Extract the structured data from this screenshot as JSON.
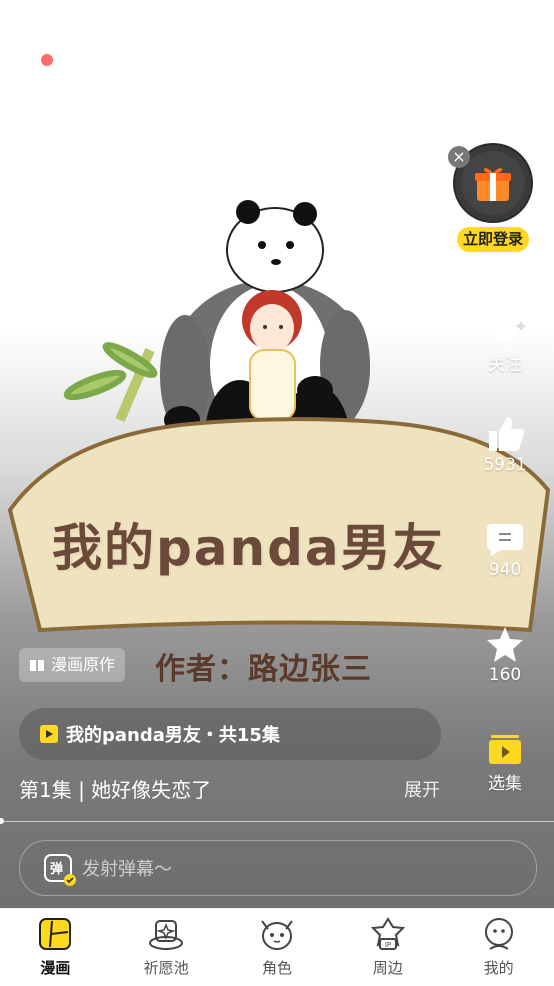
{
  "cover": {
    "banner_title": "我的panda男友",
    "author": "作者：路边张三"
  },
  "right_rail": {
    "login_label": "立即登录",
    "follow_label": "关注",
    "like_count": "5931",
    "comment_count": "940",
    "favorite_count": "160",
    "episodes_label": "选集"
  },
  "overlay": {
    "original_badge": "漫画原作",
    "series_label": "我的panda男友・共15集",
    "episode_title": "第1集 | 她好像失恋了",
    "expand_label": "展开",
    "danmaku_placeholder": "发射弹幕～",
    "danmaku_icon_char": "弹"
  },
  "tabbar": {
    "tabs": [
      {
        "label": "漫画",
        "icon": "comic-icon",
        "active": true
      },
      {
        "label": "祈愿池",
        "icon": "wish-pool-icon",
        "active": false
      },
      {
        "label": "角色",
        "icon": "character-icon",
        "active": false
      },
      {
        "label": "周边",
        "icon": "merch-ip-icon",
        "active": false
      },
      {
        "label": "我的",
        "icon": "profile-icon",
        "active": false
      }
    ]
  },
  "colors": {
    "accent_yellow": "#ffd820",
    "record_dot": "#ff6b6b",
    "banner_brown": "#6b4a3a"
  }
}
